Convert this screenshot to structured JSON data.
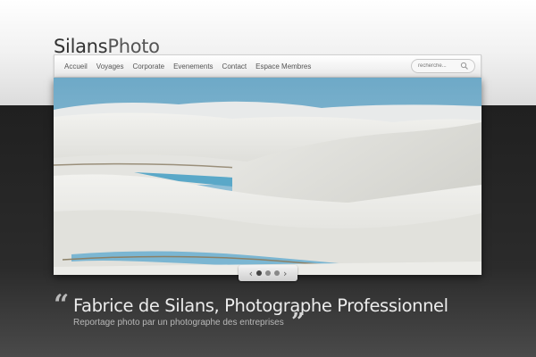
{
  "brand": {
    "name_bold": "Silans",
    "name_light": "Photo"
  },
  "nav": {
    "items": [
      {
        "label": "Accueil"
      },
      {
        "label": "Voyages"
      },
      {
        "label": "Corporate"
      },
      {
        "label": "Evenements"
      },
      {
        "label": "Contact"
      },
      {
        "label": "Espace Membres"
      }
    ]
  },
  "search": {
    "placeholder": "recherche...",
    "icon": "search-icon"
  },
  "slider": {
    "image_subject": "white sand dunes with blue lagoons",
    "slide_count": 3,
    "active_slide": 1,
    "prev_icon": "chevron-left-icon",
    "next_icon": "chevron-right-icon"
  },
  "tagline": {
    "quote_open": "“",
    "quote_close": "”",
    "headline": "Fabrice de Silans, Photographe Professionnel",
    "subline": "Reportage photo par un photographe des entreprises"
  },
  "colors": {
    "dark_band": "#202020",
    "headline": "#ececec",
    "sky": "#7fb5cf",
    "lagoon": "#5aa8c8"
  }
}
